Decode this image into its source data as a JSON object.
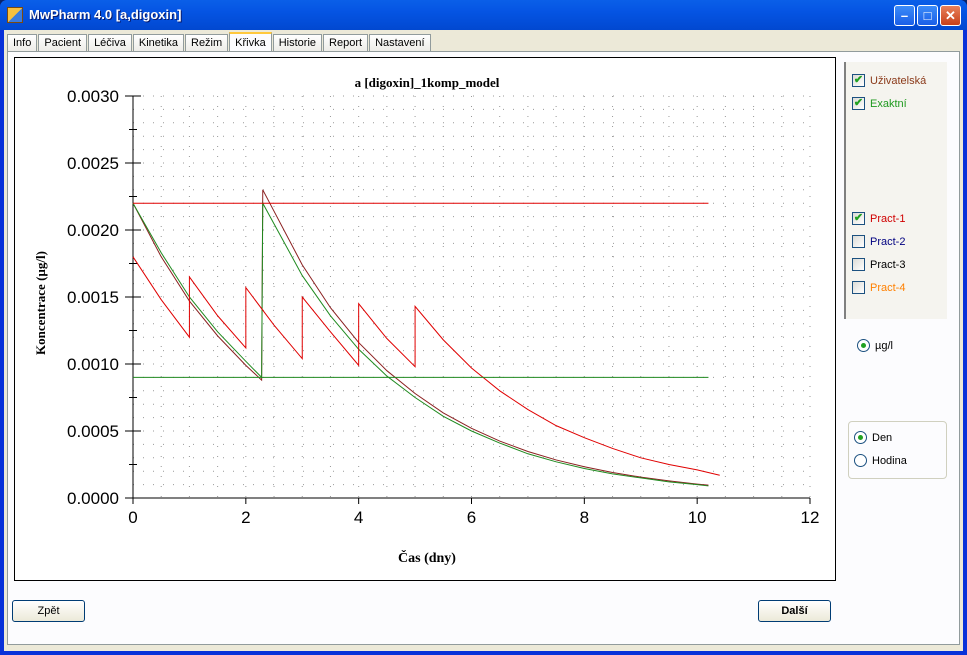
{
  "window": {
    "title": "MwPharm 4.0  [a,digoxin]"
  },
  "tabs": [
    {
      "label": "Info"
    },
    {
      "label": "Pacient"
    },
    {
      "label": "Léčiva"
    },
    {
      "label": "Kinetika"
    },
    {
      "label": "Režim"
    },
    {
      "label": "Křivka",
      "active": true
    },
    {
      "label": "Historie"
    },
    {
      "label": "Report"
    },
    {
      "label": "Nastavení"
    }
  ],
  "legend": {
    "items": [
      {
        "label": "Uživatelská",
        "checked": true,
        "color": "#8b3a1a"
      },
      {
        "label": "Exaktní",
        "checked": true,
        "color": "#1f9a1f"
      },
      {
        "label": "Pract-1",
        "checked": true,
        "color": "#d00000"
      },
      {
        "label": "Pract-2",
        "checked": false,
        "color": "#000080"
      },
      {
        "label": "Pract-3",
        "checked": false,
        "color": "#000000"
      },
      {
        "label": "Pract-4",
        "checked": false,
        "color": "#ff8000"
      }
    ]
  },
  "units": {
    "label": "µg/l",
    "selected": true
  },
  "time_unit": {
    "options": [
      {
        "label": "Den",
        "selected": true
      },
      {
        "label": "Hodina",
        "selected": false
      }
    ]
  },
  "buttons": {
    "back": "Zpět",
    "next": "Další"
  },
  "chart_data": {
    "type": "line",
    "title": "a [digoxin]_1komp_model",
    "xlabel": "Čas (dny)",
    "ylabel": "Koncentrace  (µg/l)",
    "xlim": [
      0,
      12
    ],
    "ylim": [
      0,
      0.003
    ],
    "xticks": [
      "0",
      "2",
      "4",
      "6",
      "8",
      "10",
      "12"
    ],
    "yticks": [
      "0.0000",
      "0.0005",
      "0.0010",
      "0.0015",
      "0.0020",
      "0.0025",
      "0.0030"
    ],
    "grid": "dotted",
    "series": [
      {
        "color": "#8b2020",
        "points": [
          [
            0,
            0.0022
          ],
          [
            0.5,
            0.0018
          ],
          [
            1,
            0.00147
          ],
          [
            1.5,
            0.00121
          ],
          [
            2,
            0.00099
          ],
          [
            2.28,
            0.00088
          ],
          [
            2.3,
            0.0023
          ],
          [
            3,
            0.00174
          ],
          [
            3.5,
            0.00142
          ],
          [
            4,
            0.00116
          ],
          [
            4.5,
            0.00095
          ],
          [
            5,
            0.00078
          ],
          [
            5.5,
            0.000635
          ],
          [
            6,
            0.00052
          ],
          [
            6.5,
            0.000425
          ],
          [
            7,
            0.000347
          ],
          [
            7.5,
            0.000284
          ],
          [
            8,
            0.000233
          ],
          [
            8.5,
            0.00019
          ],
          [
            9,
            0.000156
          ],
          [
            9.5,
            0.000128
          ],
          [
            10,
            0.000104
          ],
          [
            10.2,
            9.6e-05
          ]
        ]
      },
      {
        "color": "#1f8a1f",
        "points": [
          [
            0,
            0.0022
          ],
          [
            0.5,
            0.00183
          ],
          [
            1,
            0.0015
          ],
          [
            1.5,
            0.00124
          ],
          [
            2,
            0.00102
          ],
          [
            2.28,
            0.0009
          ],
          [
            2.3,
            0.0022
          ],
          [
            3,
            0.00166
          ],
          [
            3.5,
            0.00136
          ],
          [
            4,
            0.00111
          ],
          [
            4.5,
            0.00091
          ],
          [
            5,
            0.00075
          ],
          [
            5.5,
            0.00061
          ],
          [
            6,
            0.0005
          ],
          [
            6.5,
            0.00041
          ],
          [
            7,
            0.00033
          ],
          [
            7.5,
            0.00027
          ],
          [
            8,
            0.00022
          ],
          [
            8.5,
            0.00018
          ],
          [
            9,
            0.00015
          ],
          [
            9.5,
            0.00012
          ],
          [
            10,
            0.0001
          ],
          [
            10.2,
            9e-05
          ]
        ]
      },
      {
        "color": "#e00000",
        "points": [
          [
            0,
            0.0018
          ],
          [
            0.5,
            0.00148
          ],
          [
            1,
            0.0012
          ],
          [
            1,
            0.00165
          ],
          [
            1.5,
            0.00136
          ],
          [
            2,
            0.00112
          ],
          [
            2,
            0.00157
          ],
          [
            2.5,
            0.00129
          ],
          [
            3,
            0.00104
          ],
          [
            3,
            0.0015
          ],
          [
            3.5,
            0.00124
          ],
          [
            4,
            0.00099
          ],
          [
            4,
            0.00145
          ],
          [
            4.5,
            0.00119
          ],
          [
            5,
            0.00098
          ],
          [
            5,
            0.00143
          ],
          [
            5.5,
            0.00118
          ],
          [
            6,
            0.00097
          ],
          [
            6.5,
            0.0008
          ],
          [
            7,
            0.00066
          ],
          [
            7.5,
            0.00054
          ],
          [
            8,
            0.00045
          ],
          [
            8.5,
            0.00037
          ],
          [
            9,
            0.0003
          ],
          [
            9.5,
            0.00025
          ],
          [
            10,
            0.00021
          ],
          [
            10.4,
            0.00017
          ]
        ]
      },
      {
        "color": "#e00000",
        "points": [
          [
            0,
            0.0022
          ],
          [
            10.2,
            0.0022
          ]
        ]
      },
      {
        "color": "#1f8a1f",
        "points": [
          [
            0,
            0.0009
          ],
          [
            10.2,
            0.0009
          ]
        ]
      }
    ]
  }
}
